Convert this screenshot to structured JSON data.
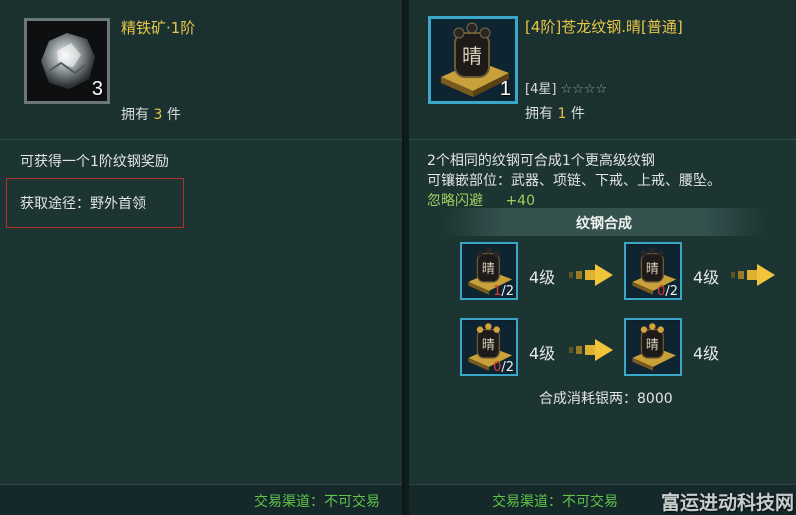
{
  "left": {
    "item_title": "精铁矿·1阶",
    "quantity": "3",
    "own_prefix": "拥有",
    "own_count": "3",
    "own_suffix": "件",
    "desc": "可获得一个1阶纹钢奖励",
    "source": "获取途径：野外首领",
    "trade": "交易渠道：不可交易"
  },
  "right": {
    "item_title": "[4阶]苍龙纹钢.晴[普通]",
    "icon_char": "晴",
    "quantity": "1",
    "stars_label": "[4星]",
    "stars": "☆☆☆☆",
    "own_prefix": "拥有",
    "own_count": "1",
    "own_suffix": "件",
    "desc1": "2个相同的纹钢可合成1个更高级纹钢",
    "desc2": "可镶嵌部位：武器、项链、下戒、上戒、腰坠。",
    "stat_name": "忽略闪避",
    "stat_value": "+40",
    "combine_title": "纹钢合成",
    "row1": [
      {
        "icon_char": "晴",
        "have": "1",
        "need": "/2",
        "level": "4级"
      },
      {
        "icon_char": "晴",
        "have": "0",
        "need": "/2",
        "level": "4级"
      }
    ],
    "row2": [
      {
        "icon_char": "晴",
        "have": "0",
        "need": "/2",
        "level": "4级"
      },
      {
        "icon_char": "晴",
        "level": "4级"
      }
    ],
    "cost": "合成消耗银两：8000",
    "trade": "交易渠道：不可交易"
  },
  "watermark": "富运进动科技网",
  "colors": {
    "gold": "#e7c64a",
    "trade_green": "#5ec44a",
    "slot_border": "#3aa6c8",
    "red": "#e23a2a"
  }
}
